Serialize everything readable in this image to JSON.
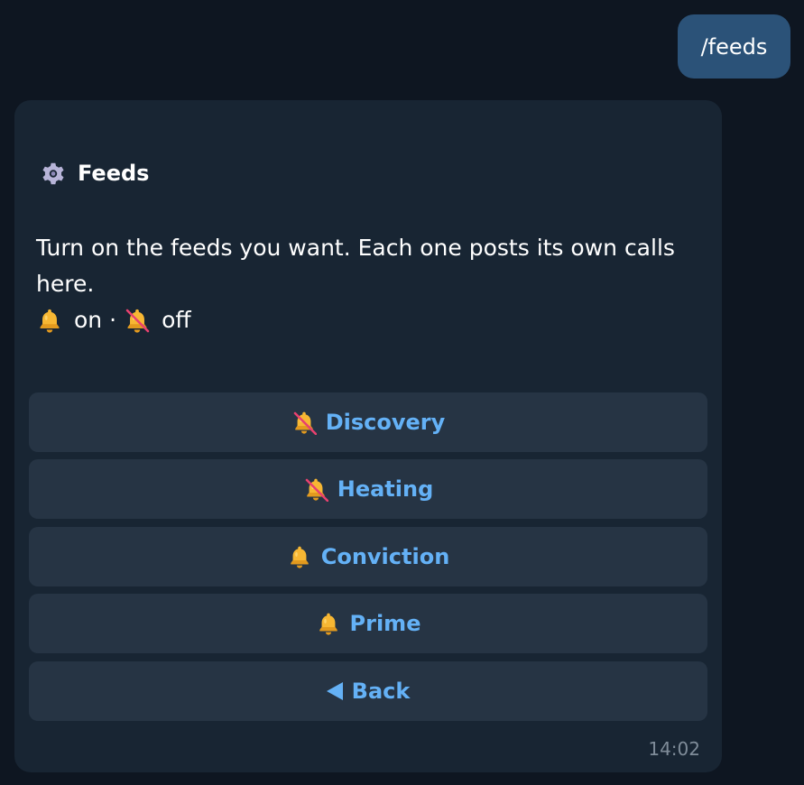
{
  "user_message": {
    "text": "/feeds"
  },
  "bot_message": {
    "title_icon": "gear-icon",
    "title": "Feeds",
    "body": "Turn on the feeds you want. Each one posts its own calls here.",
    "legend": {
      "on_label": "on",
      "separator": "·",
      "off_label": "off"
    },
    "time": "14:02"
  },
  "keyboard": {
    "buttons": [
      {
        "label": "Discovery",
        "state": "off",
        "icon": "bell-off-icon"
      },
      {
        "label": "Heating",
        "state": "off",
        "icon": "bell-off-icon"
      },
      {
        "label": "Conviction",
        "state": "on",
        "icon": "bell-icon"
      },
      {
        "label": "Prime",
        "state": "on",
        "icon": "bell-icon"
      },
      {
        "label": "Back",
        "icon": "back-arrow-icon"
      }
    ]
  },
  "colors": {
    "background": "#0e1621",
    "bot_bubble": "#182533",
    "user_bubble": "#2b5278",
    "button_bg": "#263444",
    "button_text": "#64b1f6",
    "time_text": "#7f8c99",
    "bell": "#f7b733"
  }
}
